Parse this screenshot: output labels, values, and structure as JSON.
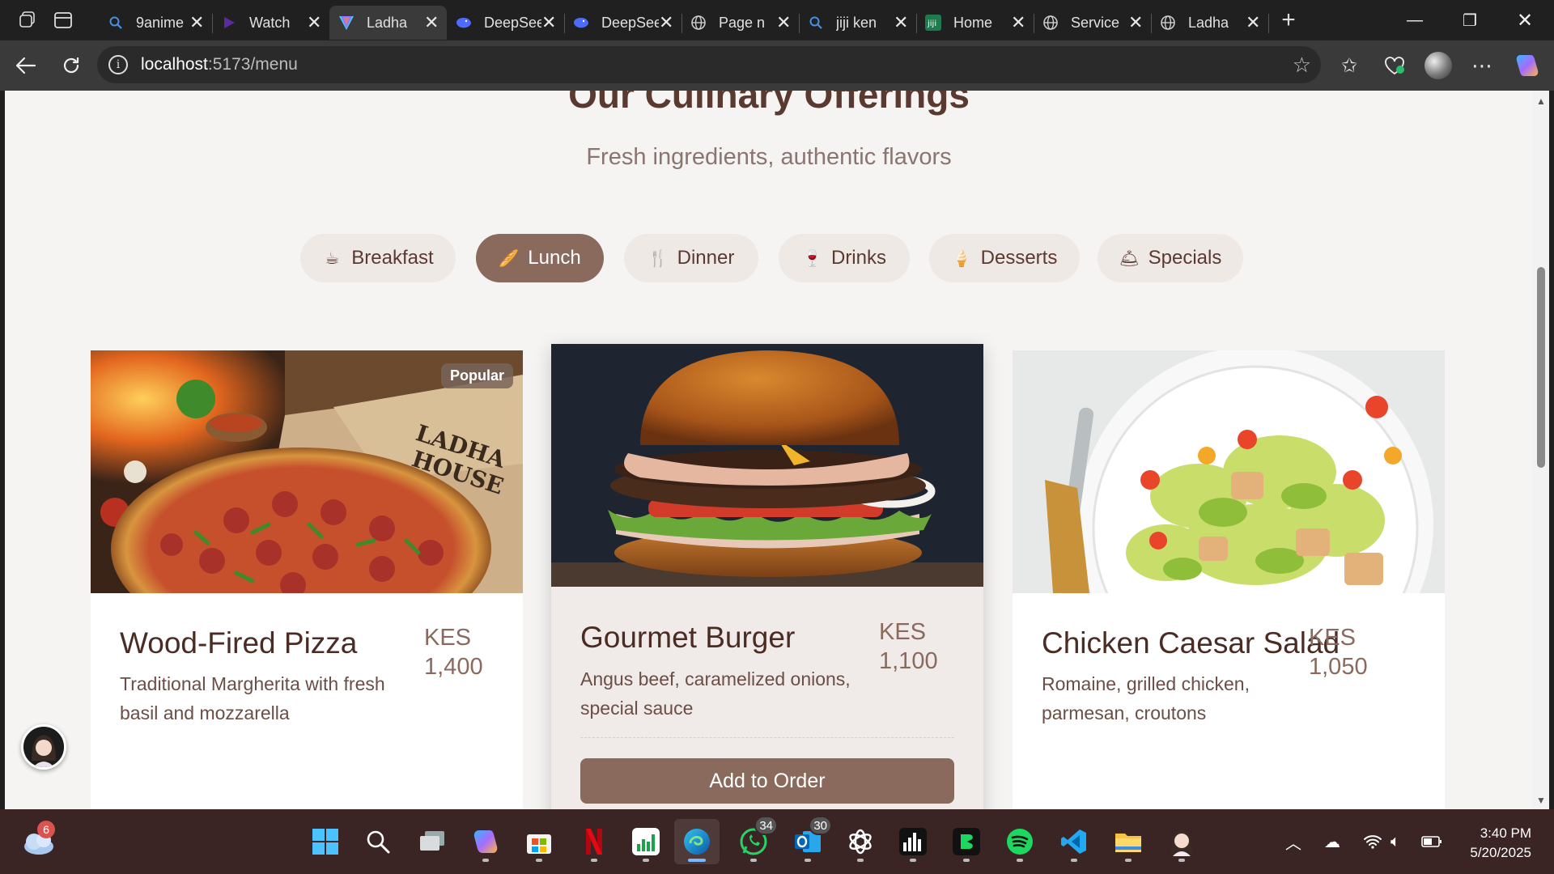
{
  "browser": {
    "tabs": [
      {
        "title": "9anime",
        "icon": "search-icon",
        "color": "#4a90e2"
      },
      {
        "title": "Watch",
        "icon": "play-icon",
        "color": "#5b2ca0"
      },
      {
        "title": "Ladha",
        "icon": "vite-icon",
        "color": "#bd34fe",
        "active": true
      },
      {
        "title": "DeepSeek",
        "icon": "whale-icon",
        "color": "#4d6bfe"
      },
      {
        "title": "DeepSeek",
        "icon": "whale-icon",
        "color": "#4d6bfe"
      },
      {
        "title": "Page n",
        "icon": "globe-icon",
        "color": "#cccccc"
      },
      {
        "title": "jiji ken",
        "icon": "search-icon",
        "color": "#4a90e2"
      },
      {
        "title": "Home",
        "icon": "jiji-icon",
        "color": "#1f7a4d"
      },
      {
        "title": "Service",
        "icon": "globe-icon",
        "color": "#cccccc"
      },
      {
        "title": "Ladha",
        "icon": "globe-icon",
        "color": "#cccccc"
      }
    ],
    "close_glyph": "✕",
    "url_host": "localhost",
    "url_path": ":5173/menu"
  },
  "page": {
    "heading": "Our Culinary Offerings",
    "subheading": "Fresh ingredients, authentic flavors",
    "categories": [
      {
        "label": "Breakfast",
        "icon": "coffee-icon",
        "glyph": "☕"
      },
      {
        "label": "Lunch",
        "icon": "bread-icon",
        "glyph": "🥖",
        "active": true
      },
      {
        "label": "Dinner",
        "icon": "utensils-icon",
        "glyph": "🍴"
      },
      {
        "label": "Drinks",
        "icon": "wine-glass-icon",
        "glyph": "🍷"
      },
      {
        "label": "Desserts",
        "icon": "ice-cream-icon",
        "glyph": "🍦"
      },
      {
        "label": "Specials",
        "icon": "concierge-bell-icon",
        "glyph": "🛎"
      }
    ],
    "items": [
      {
        "name": "Wood-Fired Pizza",
        "currency": "KES",
        "price": "1,400",
        "description": "Traditional Margherita with fresh basil and mozzarella",
        "badge": "Popular",
        "image": "pizza-image"
      },
      {
        "name": "Gourmet Burger",
        "currency": "KES",
        "price": "1,100",
        "description": "Angus beef, caramelized onions, special sauce",
        "image": "burger-image",
        "button": "Add to Order"
      },
      {
        "name": "Chicken Caesar Salad",
        "currency": "KES",
        "price": "1,050",
        "description": "Romaine, grilled chicken, parmesan, croutons",
        "image": "salad-image"
      }
    ]
  },
  "taskbar": {
    "weather_badge": "6",
    "apps": [
      {
        "name": "start-icon"
      },
      {
        "name": "search-icon"
      },
      {
        "name": "task-view-icon"
      },
      {
        "name": "copilot-icon"
      },
      {
        "name": "microsoft-store-icon"
      },
      {
        "name": "netflix-icon"
      },
      {
        "name": "stocks-icon"
      },
      {
        "name": "edge-icon",
        "active": true
      },
      {
        "name": "whatsapp-icon",
        "badge": "34"
      },
      {
        "name": "outlook-icon",
        "badge": "30"
      },
      {
        "name": "chatgpt-icon"
      },
      {
        "name": "deezer-icon"
      },
      {
        "name": "spotify-alt-icon"
      },
      {
        "name": "spotify-icon"
      },
      {
        "name": "vscode-icon"
      },
      {
        "name": "file-explorer-icon"
      },
      {
        "name": "avatar-app-icon"
      }
    ],
    "time": "3:40 PM",
    "date": "5/20/2025"
  },
  "colors": {
    "accent": "#8b6a5e",
    "heading": "#5a3a30",
    "page_bg": "#f5f4f3"
  }
}
